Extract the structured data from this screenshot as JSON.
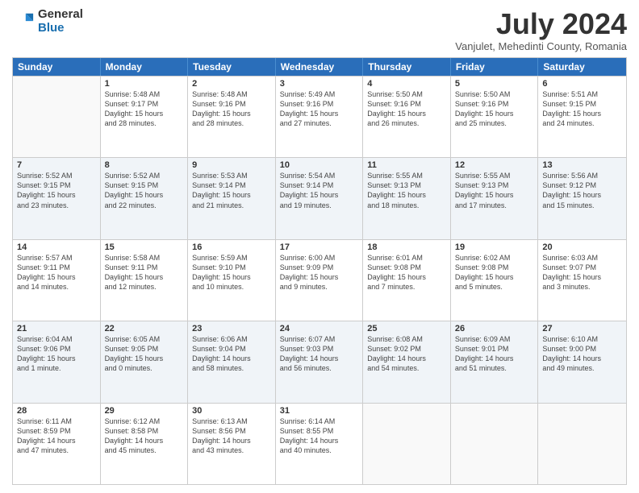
{
  "logo": {
    "general": "General",
    "blue": "Blue"
  },
  "title": "July 2024",
  "subtitle": "Vanjulet, Mehedinti County, Romania",
  "weekdays": [
    "Sunday",
    "Monday",
    "Tuesday",
    "Wednesday",
    "Thursday",
    "Friday",
    "Saturday"
  ],
  "weeks": [
    [
      {
        "day": "",
        "sunrise": "",
        "sunset": "",
        "daylight": ""
      },
      {
        "day": "1",
        "sunrise": "Sunrise: 5:48 AM",
        "sunset": "Sunset: 9:17 PM",
        "daylight": "Daylight: 15 hours and 28 minutes."
      },
      {
        "day": "2",
        "sunrise": "Sunrise: 5:48 AM",
        "sunset": "Sunset: 9:16 PM",
        "daylight": "Daylight: 15 hours and 28 minutes."
      },
      {
        "day": "3",
        "sunrise": "Sunrise: 5:49 AM",
        "sunset": "Sunset: 9:16 PM",
        "daylight": "Daylight: 15 hours and 27 minutes."
      },
      {
        "day": "4",
        "sunrise": "Sunrise: 5:50 AM",
        "sunset": "Sunset: 9:16 PM",
        "daylight": "Daylight: 15 hours and 26 minutes."
      },
      {
        "day": "5",
        "sunrise": "Sunrise: 5:50 AM",
        "sunset": "Sunset: 9:16 PM",
        "daylight": "Daylight: 15 hours and 25 minutes."
      },
      {
        "day": "6",
        "sunrise": "Sunrise: 5:51 AM",
        "sunset": "Sunset: 9:15 PM",
        "daylight": "Daylight: 15 hours and 24 minutes."
      }
    ],
    [
      {
        "day": "7",
        "sunrise": "Sunrise: 5:52 AM",
        "sunset": "Sunset: 9:15 PM",
        "daylight": "Daylight: 15 hours and 23 minutes."
      },
      {
        "day": "8",
        "sunrise": "Sunrise: 5:52 AM",
        "sunset": "Sunset: 9:15 PM",
        "daylight": "Daylight: 15 hours and 22 minutes."
      },
      {
        "day": "9",
        "sunrise": "Sunrise: 5:53 AM",
        "sunset": "Sunset: 9:14 PM",
        "daylight": "Daylight: 15 hours and 21 minutes."
      },
      {
        "day": "10",
        "sunrise": "Sunrise: 5:54 AM",
        "sunset": "Sunset: 9:14 PM",
        "daylight": "Daylight: 15 hours and 19 minutes."
      },
      {
        "day": "11",
        "sunrise": "Sunrise: 5:55 AM",
        "sunset": "Sunset: 9:13 PM",
        "daylight": "Daylight: 15 hours and 18 minutes."
      },
      {
        "day": "12",
        "sunrise": "Sunrise: 5:55 AM",
        "sunset": "Sunset: 9:13 PM",
        "daylight": "Daylight: 15 hours and 17 minutes."
      },
      {
        "day": "13",
        "sunrise": "Sunrise: 5:56 AM",
        "sunset": "Sunset: 9:12 PM",
        "daylight": "Daylight: 15 hours and 15 minutes."
      }
    ],
    [
      {
        "day": "14",
        "sunrise": "Sunrise: 5:57 AM",
        "sunset": "Sunset: 9:11 PM",
        "daylight": "Daylight: 15 hours and 14 minutes."
      },
      {
        "day": "15",
        "sunrise": "Sunrise: 5:58 AM",
        "sunset": "Sunset: 9:11 PM",
        "daylight": "Daylight: 15 hours and 12 minutes."
      },
      {
        "day": "16",
        "sunrise": "Sunrise: 5:59 AM",
        "sunset": "Sunset: 9:10 PM",
        "daylight": "Daylight: 15 hours and 10 minutes."
      },
      {
        "day": "17",
        "sunrise": "Sunrise: 6:00 AM",
        "sunset": "Sunset: 9:09 PM",
        "daylight": "Daylight: 15 hours and 9 minutes."
      },
      {
        "day": "18",
        "sunrise": "Sunrise: 6:01 AM",
        "sunset": "Sunset: 9:08 PM",
        "daylight": "Daylight: 15 hours and 7 minutes."
      },
      {
        "day": "19",
        "sunrise": "Sunrise: 6:02 AM",
        "sunset": "Sunset: 9:08 PM",
        "daylight": "Daylight: 15 hours and 5 minutes."
      },
      {
        "day": "20",
        "sunrise": "Sunrise: 6:03 AM",
        "sunset": "Sunset: 9:07 PM",
        "daylight": "Daylight: 15 hours and 3 minutes."
      }
    ],
    [
      {
        "day": "21",
        "sunrise": "Sunrise: 6:04 AM",
        "sunset": "Sunset: 9:06 PM",
        "daylight": "Daylight: 15 hours and 1 minute."
      },
      {
        "day": "22",
        "sunrise": "Sunrise: 6:05 AM",
        "sunset": "Sunset: 9:05 PM",
        "daylight": "Daylight: 15 hours and 0 minutes."
      },
      {
        "day": "23",
        "sunrise": "Sunrise: 6:06 AM",
        "sunset": "Sunset: 9:04 PM",
        "daylight": "Daylight: 14 hours and 58 minutes."
      },
      {
        "day": "24",
        "sunrise": "Sunrise: 6:07 AM",
        "sunset": "Sunset: 9:03 PM",
        "daylight": "Daylight: 14 hours and 56 minutes."
      },
      {
        "day": "25",
        "sunrise": "Sunrise: 6:08 AM",
        "sunset": "Sunset: 9:02 PM",
        "daylight": "Daylight: 14 hours and 54 minutes."
      },
      {
        "day": "26",
        "sunrise": "Sunrise: 6:09 AM",
        "sunset": "Sunset: 9:01 PM",
        "daylight": "Daylight: 14 hours and 51 minutes."
      },
      {
        "day": "27",
        "sunrise": "Sunrise: 6:10 AM",
        "sunset": "Sunset: 9:00 PM",
        "daylight": "Daylight: 14 hours and 49 minutes."
      }
    ],
    [
      {
        "day": "28",
        "sunrise": "Sunrise: 6:11 AM",
        "sunset": "Sunset: 8:59 PM",
        "daylight": "Daylight: 14 hours and 47 minutes."
      },
      {
        "day": "29",
        "sunrise": "Sunrise: 6:12 AM",
        "sunset": "Sunset: 8:58 PM",
        "daylight": "Daylight: 14 hours and 45 minutes."
      },
      {
        "day": "30",
        "sunrise": "Sunrise: 6:13 AM",
        "sunset": "Sunset: 8:56 PM",
        "daylight": "Daylight: 14 hours and 43 minutes."
      },
      {
        "day": "31",
        "sunrise": "Sunrise: 6:14 AM",
        "sunset": "Sunset: 8:55 PM",
        "daylight": "Daylight: 14 hours and 40 minutes."
      },
      {
        "day": "",
        "sunrise": "",
        "sunset": "",
        "daylight": ""
      },
      {
        "day": "",
        "sunrise": "",
        "sunset": "",
        "daylight": ""
      },
      {
        "day": "",
        "sunrise": "",
        "sunset": "",
        "daylight": ""
      }
    ]
  ]
}
